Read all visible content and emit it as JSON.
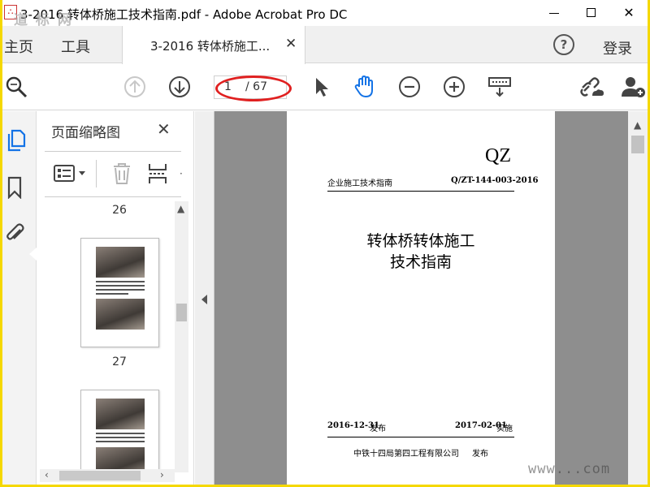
{
  "window": {
    "title": "3-2016 转体桥施工技术指南.pdf - Adobe Acrobat Pro DC",
    "minimize_label": "—",
    "maximize_label": "☐",
    "close_label": "✕"
  },
  "watermarks": {
    "top_left": "道  标  网",
    "bottom_right": "www...com"
  },
  "tabs": {
    "home": "主页",
    "tools": "工具",
    "document_tab": "3-2016 转体桥施工...",
    "document_tab_close": "✕",
    "help": "?",
    "login": "登录"
  },
  "toolbar": {
    "current_page": "1",
    "total_pages": "/ 67",
    "icons": [
      "search-zoom",
      "previous-page",
      "next-page",
      "select-pointer",
      "hand-tool",
      "zoom-out",
      "zoom-in",
      "page-display",
      "share-link",
      "add-user"
    ]
  },
  "sidebar": {
    "panel_title": "页面缩略图",
    "panel_close": "✕",
    "thumbnails": [
      {
        "page_label": "26"
      },
      {
        "page_label": "27"
      }
    ]
  },
  "document_page": {
    "header_code": "QZ",
    "header_left": "企业施工技术指南",
    "header_right": "Q/ZT-144-003-2016",
    "title_line1": "转体桥转体施工",
    "title_line2": "技术指南",
    "issue_date": "2016-12-31",
    "issue_label": "发布",
    "effective_date": "2017-02-01",
    "effective_label": "实施",
    "publisher": "中铁十四局第四工程有限公司",
    "publisher_label": "发布"
  },
  "colors": {
    "frame_yellow": "#f5d800",
    "highlight_red": "#e02020",
    "hand_tool_blue": "#1473e6",
    "doc_background": "#8e8e8e"
  }
}
